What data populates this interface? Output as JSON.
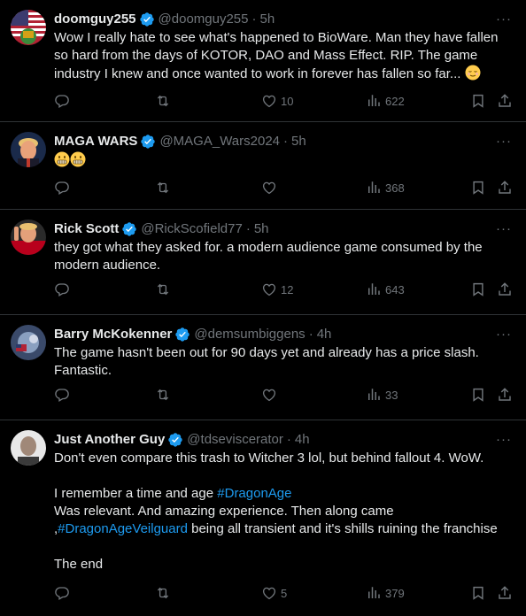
{
  "tweets": [
    {
      "name": "doomguy255",
      "handle": "@doomguy255",
      "time": "5h",
      "verified": true,
      "text": "Wow I really hate to see what's happened to BioWare. Man they have fallen so hard from the days of KOTOR, DAO and Mass Effect. RIP. The game industry I knew and once wanted to work in forever has fallen so far...",
      "emoji_suffix": "relieved-face",
      "likes": "10",
      "views": "622",
      "replies": "",
      "retweets": ""
    },
    {
      "name": "MAGA WARS",
      "handle": "@MAGA_Wars2024",
      "time": "5h",
      "verified": true,
      "text": "",
      "emoji_suffix": "grimacing-faces",
      "likes": "",
      "views": "368",
      "replies": "",
      "retweets": ""
    },
    {
      "name": "Rick Scott",
      "handle": "@RickScofield77",
      "time": "5h",
      "verified": true,
      "text": "they got what they asked for. a modern audience game consumed by the modern audience.",
      "likes": "12",
      "views": "643",
      "replies": "",
      "retweets": ""
    },
    {
      "name": "Barry McKokenner",
      "handle": "@demsumbiggens",
      "time": "4h",
      "verified": true,
      "text": "The game hasn't been out for 90 days yet and already has a price slash. Fantastic.",
      "likes": "",
      "views": "33",
      "replies": "",
      "retweets": ""
    },
    {
      "name": "Just Another Guy",
      "handle": "@tdseviscerator",
      "time": "4h",
      "verified": true,
      "text_line1": "Don't even compare this trash to Witcher 3 lol, but behind fallout 4. WoW.",
      "text_line2a": "I remember a time and age ",
      "hashtag1": "#DragonAge",
      "text_line3": "Was relevant. And amazing experience. Then along came",
      "text_line4a": ",",
      "hashtag2": "#DragonAgeVeilguard",
      "text_line4b": " being all transient and it's shills ruining the franchise",
      "text_line5": "The end",
      "likes": "5",
      "views": "379",
      "replies": "",
      "retweets": ""
    }
  ],
  "colors": {
    "background": "#000000",
    "text": "#e7e9ea",
    "muted": "#71767b",
    "accent": "#1d9bf0",
    "divider": "#2f3336"
  },
  "icons": [
    "reply-icon",
    "retweet-icon",
    "like-icon",
    "views-icon",
    "bookmark-icon",
    "share-icon",
    "more-icon",
    "verified-badge-icon"
  ]
}
